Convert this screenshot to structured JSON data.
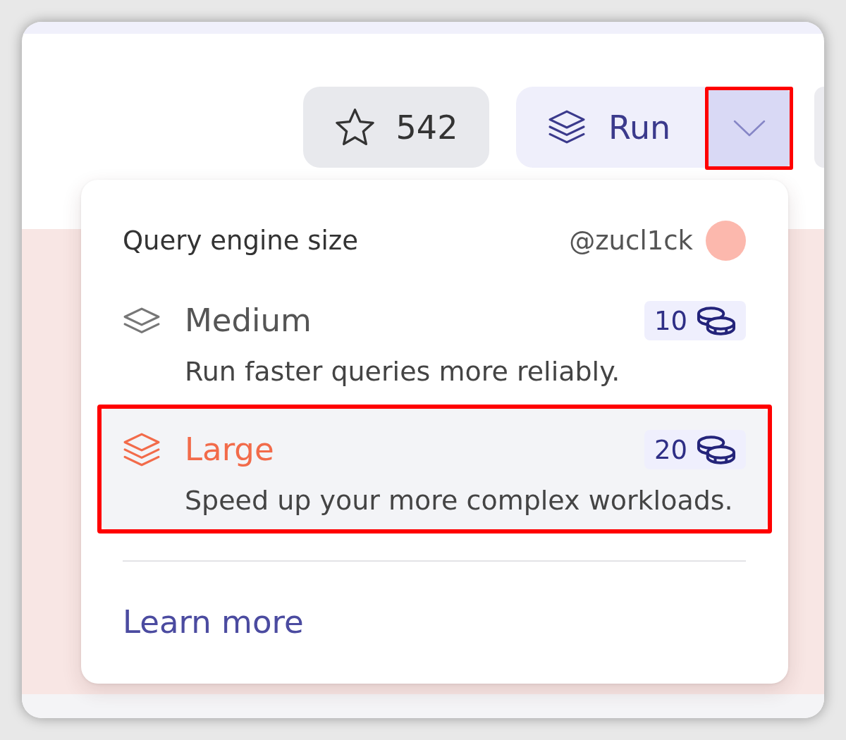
{
  "toolbar": {
    "star_button": {
      "count": "542"
    },
    "run_button": {
      "label": "Run"
    },
    "dropdown_toggle": {
      "expanded": true,
      "annotated": true
    }
  },
  "menu": {
    "title": "Query engine size",
    "user_handle": "@zucl1ck",
    "options": [
      {
        "kind": "medium",
        "name": "Medium",
        "cost": "10",
        "description": "Run faster queries more reliably.",
        "selected": false,
        "annotated": false
      },
      {
        "kind": "large",
        "name": "Large",
        "cost": "20",
        "description": "Speed up your more complex workloads.",
        "selected": true,
        "annotated": true
      }
    ],
    "link": "Learn more"
  }
}
